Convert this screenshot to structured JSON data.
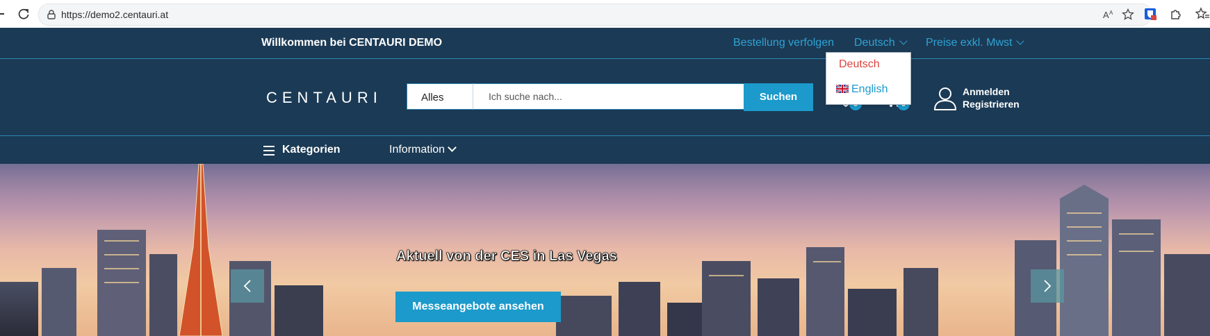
{
  "browser": {
    "url": "https://demo2.centauri.at"
  },
  "topbar": {
    "welcome": "Willkommen bei CENTAURI DEMO",
    "track_order": "Bestellung verfolgen",
    "language": "Deutsch",
    "prices": "Preise exkl. Mwst"
  },
  "language_menu": {
    "options": [
      "Deutsch",
      "English"
    ],
    "selected": "Deutsch"
  },
  "header": {
    "logo": "CENTAURI",
    "search": {
      "category": "Alles",
      "placeholder": "Ich suche nach...",
      "button": "Suchen"
    },
    "wishlist_count": "0",
    "cart_count": "0",
    "login": "Anmelden",
    "register": "Registrieren"
  },
  "nav": {
    "categories": "Kategorien",
    "information": "Information"
  },
  "hero": {
    "title": "Aktuell von der CES in Las Vegas",
    "button": "Messeangebote ansehen"
  },
  "colors": {
    "navy": "#1b3a55",
    "accent": "#1c9acb",
    "active_lang": "#d9443e"
  }
}
